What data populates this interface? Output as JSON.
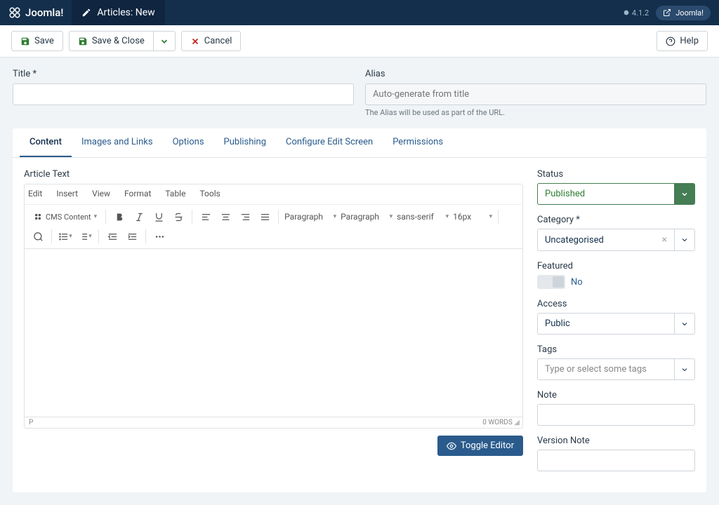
{
  "topbar": {
    "brand": "Joomla!",
    "page_title": "Articles: New",
    "version": "4.1.2",
    "user": "Joomla!"
  },
  "actions": {
    "save": "Save",
    "save_close": "Save & Close",
    "cancel": "Cancel",
    "help": "Help"
  },
  "fields": {
    "title_label": "Title",
    "alias_label": "Alias",
    "alias_placeholder": "Auto-generate from title",
    "alias_help": "The Alias will be used as part of the URL."
  },
  "tabs": [
    "Content",
    "Images and Links",
    "Options",
    "Publishing",
    "Configure Edit Screen",
    "Permissions"
  ],
  "editor": {
    "label": "Article Text",
    "menus": [
      "Edit",
      "Insert",
      "View",
      "Format",
      "Table",
      "Tools"
    ],
    "cms_btn": "CMS Content",
    "sel_block": "Paragraph",
    "sel_style": "Paragraph",
    "sel_font": "sans-serif",
    "sel_size": "16px",
    "status_path": "P",
    "status_words": "0 WORDS",
    "toggle": "Toggle Editor"
  },
  "sidebar": {
    "status_label": "Status",
    "status_value": "Published",
    "category_label": "Category",
    "category_value": "Uncategorised",
    "featured_label": "Featured",
    "featured_value": "No",
    "access_label": "Access",
    "access_value": "Public",
    "tags_label": "Tags",
    "tags_placeholder": "Type or select some tags",
    "note_label": "Note",
    "version_note_label": "Version Note"
  }
}
